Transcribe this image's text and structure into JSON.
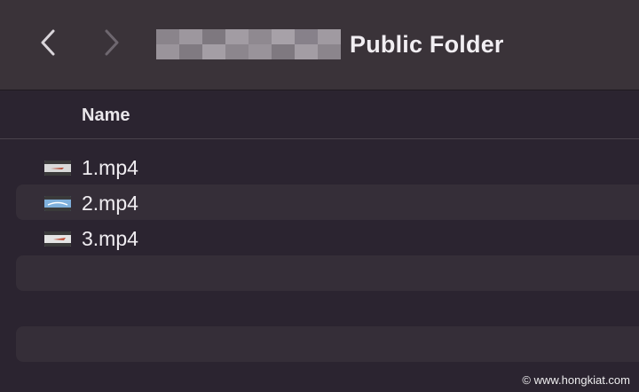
{
  "toolbar": {
    "back_icon": "chevron-left-icon",
    "forward_icon": "chevron-right-icon",
    "title": "Public Folder"
  },
  "list_header": {
    "name_column": "Name"
  },
  "files": [
    {
      "name": "1.mp4",
      "icon": "video-thumbnail-icon"
    },
    {
      "name": "2.mp4",
      "icon": "video-thumbnail-icon"
    },
    {
      "name": "3.mp4",
      "icon": "video-thumbnail-icon"
    }
  ],
  "watermark": "© www.hongkiat.com",
  "colors": {
    "toolbar_bg": "#3a3339",
    "list_bg": "#2b2430",
    "alt_row_bg": "#352e38"
  }
}
